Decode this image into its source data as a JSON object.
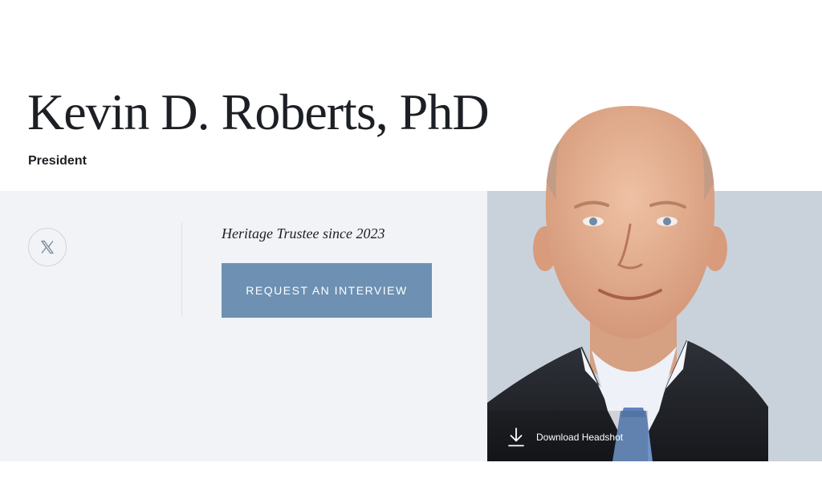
{
  "profile": {
    "name": "Kevin D. Roberts, PhD",
    "title": "President",
    "trustee_note": "Heritage Trustee since 2023"
  },
  "social": {
    "icon": "x-logo-icon"
  },
  "actions": {
    "interview_label": "REQUEST AN INTERVIEW",
    "download_label": "Download Headshot"
  },
  "colors": {
    "band_background": "#f1f3f7",
    "button_background": "#6d90b3",
    "photo_backdrop": "#c9d2db",
    "text": "#1c1f24"
  }
}
